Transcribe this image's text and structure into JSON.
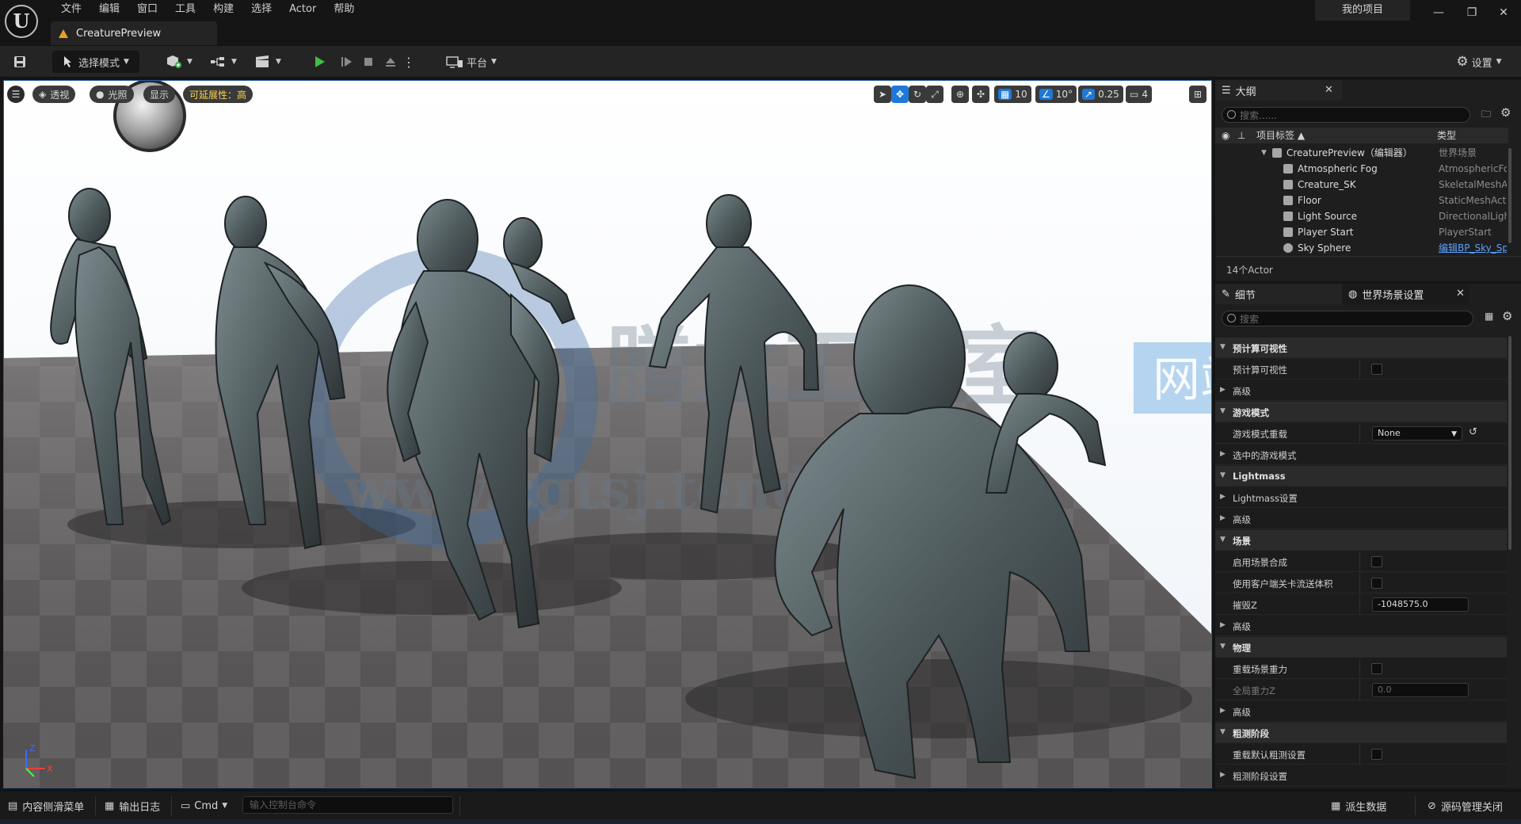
{
  "titlebar": {
    "logo_text": "U",
    "menu": [
      "文件",
      "编辑",
      "窗口",
      "工具",
      "构建",
      "选择",
      "Actor",
      "帮助"
    ],
    "doc_tab": "CreaturePreview",
    "project_button": "我的项目",
    "minimize": "—",
    "restore": "❐",
    "close": "✕"
  },
  "toolbar": {
    "save_icon": "save-icon",
    "mode_label": "选择模式",
    "platform_label": "平台",
    "settings_label": "设置"
  },
  "viewport": {
    "menu_glyph": "☰",
    "perspective": "透视",
    "lighting": "光照",
    "show": "显示",
    "scalability": "可延展性：高",
    "grid_snap": "10",
    "rot_snap": "10°",
    "scale_snap": "0.25",
    "cam_speed": "4",
    "watermark_cn": "腾龙工作室",
    "watermark_badge": "网站",
    "watermark_url": "www.cgtsj.tendio.com",
    "axis_z": "Z",
    "axis_x": "X",
    "accent": "#1f78d8"
  },
  "outliner": {
    "tab_label": "大纲",
    "search_placeholder": "搜索......",
    "col_label": "项目标签 ▲",
    "col_type": "类型",
    "rows": [
      {
        "label": "CreaturePreview（编辑器）",
        "type": "世界场景"
      },
      {
        "label": "Atmospheric Fog",
        "type": "AtmosphericFog"
      },
      {
        "label": "Creature_SK",
        "type": "SkeletalMeshActor"
      },
      {
        "label": "Floor",
        "type": "StaticMeshActor"
      },
      {
        "label": "Light Source",
        "type": "DirectionalLight"
      },
      {
        "label": "Player Start",
        "type": "PlayerStart"
      },
      {
        "label": "Sky Sphere",
        "type": "编辑BP_Sky_Sphere"
      }
    ],
    "count": "14个Actor"
  },
  "details": {
    "tab_details": "细节",
    "tab_world": "世界场景设置",
    "search_placeholder": "搜索",
    "rows": [
      {
        "kind": "cat",
        "label": "预计算可视性"
      },
      {
        "kind": "check",
        "label": "预计算可视性"
      },
      {
        "kind": "sub",
        "label": "高级"
      },
      {
        "kind": "cat",
        "label": "游戏模式"
      },
      {
        "kind": "dropdown",
        "label": "游戏模式重载",
        "value": "None"
      },
      {
        "kind": "sub",
        "label": "选中的游戏模式"
      },
      {
        "kind": "cat",
        "label": "Lightmass"
      },
      {
        "kind": "sub",
        "label": "Lightmass设置"
      },
      {
        "kind": "sub",
        "label": "高级"
      },
      {
        "kind": "cat",
        "label": "场景"
      },
      {
        "kind": "check",
        "label": "启用场景合成"
      },
      {
        "kind": "check",
        "label": "使用客户端关卡流送体积"
      },
      {
        "kind": "number",
        "label": "摧毁Z",
        "value": "-1048575.0"
      },
      {
        "kind": "sub",
        "label": "高级"
      },
      {
        "kind": "cat",
        "label": "物理"
      },
      {
        "kind": "check",
        "label": "重载场景重力"
      },
      {
        "kind": "number_dim",
        "label": "全局重力Z",
        "value": "0.0"
      },
      {
        "kind": "sub",
        "label": "高级"
      },
      {
        "kind": "cat",
        "label": "粗测阶段"
      },
      {
        "kind": "check",
        "label": "重载默认粗测设置"
      },
      {
        "kind": "sub",
        "label": "粗测阶段设置"
      }
    ]
  },
  "statusbar": {
    "content_drawer": "内容侧滑菜单",
    "output_log": "输出日志",
    "cmd": "Cmd",
    "cmd_placeholder": "输入控制台命令",
    "derived_data": "派生数据",
    "source_control": "源码管理关闭"
  }
}
